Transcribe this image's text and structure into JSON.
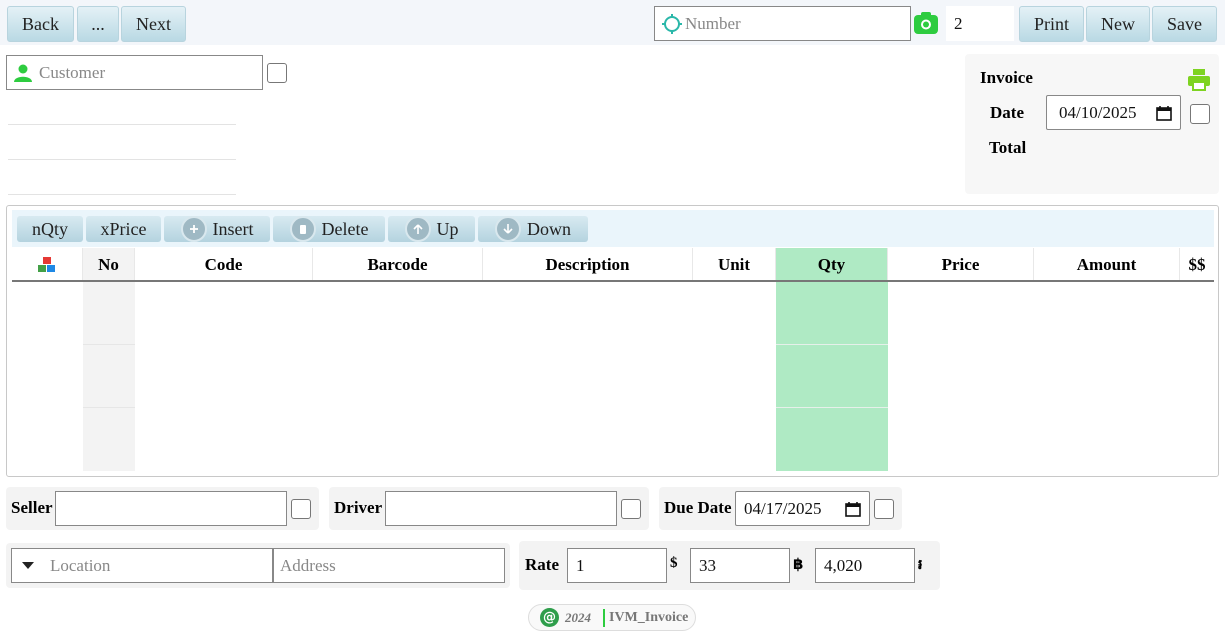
{
  "toolbar": {
    "back_label": "Back",
    "more_label": "...",
    "next_label": "Next",
    "number_placeholder": "Number",
    "copies_value": "2",
    "print_label": "Print",
    "new_label": "New",
    "save_label": "Save"
  },
  "customer": {
    "placeholder": "Customer"
  },
  "invoice": {
    "heading": "Invoice",
    "date_label": "Date",
    "date_value": "04/10/2025",
    "total_label": "Total"
  },
  "grid": {
    "actions": [
      {
        "label": "nQty",
        "icon": ""
      },
      {
        "label": "xPrice",
        "icon": ""
      },
      {
        "label": "Insert",
        "icon": "plus-circle-icon"
      },
      {
        "label": "Delete",
        "icon": "trash-icon"
      },
      {
        "label": "Up",
        "icon": "arrow-up-icon"
      },
      {
        "label": "Down",
        "icon": "arrow-down-icon"
      }
    ],
    "columns": [
      "",
      "No",
      "Code",
      "Barcode",
      "Description",
      "Unit",
      "Qty",
      "Price",
      "Amount",
      "$$"
    ],
    "highlight_color": "#afeac4"
  },
  "bottom": {
    "seller_label": "Seller",
    "driver_label": "Driver",
    "due_date_label": "Due Date",
    "due_date_value": "04/17/2025",
    "location_placeholder": "Location",
    "address_placeholder": "Address",
    "rate_label": "Rate",
    "rate_usd": "1",
    "usd_symbol": "$",
    "rate_thb": "33",
    "thb_symbol": "฿",
    "rate_khr": "4,020",
    "khr_symbol": "៛"
  },
  "footer": {
    "year": "2024",
    "brand": "IVM_Invoice"
  },
  "colors": {
    "accent_green": "#2ecc40",
    "button_blue": "#b9d9e4"
  }
}
